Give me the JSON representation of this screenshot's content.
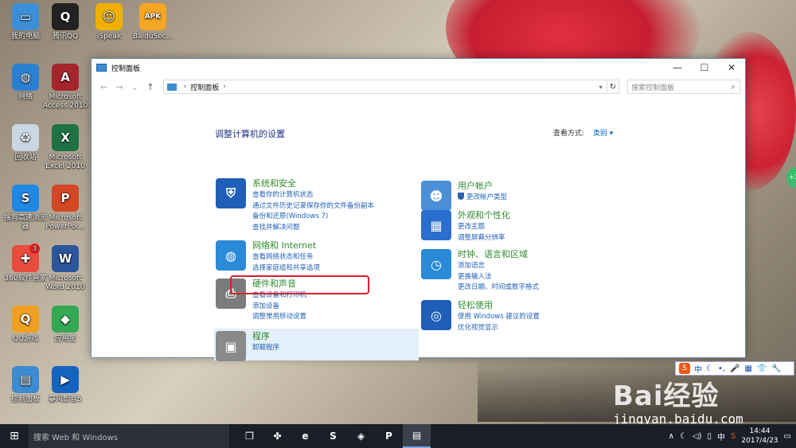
{
  "desktop": {
    "icons": [
      {
        "label": "我的电脑",
        "icon": "computer-icon",
        "color": "#3c8fd6",
        "glyph": "▭"
      },
      {
        "label": "腾讯QQ",
        "icon": "qq-icon",
        "color": "#222222",
        "glyph": "Q"
      },
      {
        "label": "iSpeak",
        "icon": "ispeak-icon",
        "color": "#f0b000",
        "glyph": "☺"
      },
      {
        "label": "BaiduSec...",
        "icon": "apk-icon",
        "color": "#f5a623",
        "glyph": "APK"
      },
      {
        "label": "网络",
        "icon": "network-icon",
        "color": "#2b7fd0",
        "glyph": "◍"
      },
      {
        "label": "Microsoft Access 2010",
        "icon": "access-icon",
        "color": "#a4262c",
        "glyph": "A"
      },
      {
        "label": "回收站",
        "icon": "recycle-bin-icon",
        "color": "#c9d6e3",
        "glyph": "♻"
      },
      {
        "label": "Microsoft Excel 2010",
        "icon": "excel-icon",
        "color": "#1f7244",
        "glyph": "X"
      },
      {
        "label": "搜狗高速浏览器",
        "icon": "sogou-browser-icon",
        "color": "#1e88e5",
        "glyph": "S"
      },
      {
        "label": "Microsoft PowerPoi...",
        "icon": "powerpoint-icon",
        "color": "#d24726",
        "glyph": "P"
      },
      {
        "label": "360软件管家",
        "icon": "360-manager-icon",
        "color": "#e84c3d",
        "glyph": "✚"
      },
      {
        "label": "Microsoft Word 2010",
        "icon": "word-icon",
        "color": "#2b579a",
        "glyph": "W"
      },
      {
        "label": "QQ游戏",
        "icon": "qq-game-icon",
        "color": "#f0a020",
        "glyph": "Q"
      },
      {
        "label": "应用宝",
        "icon": "yingyongbao-icon",
        "color": "#34a853",
        "glyph": "◆"
      },
      {
        "label": "控制面板",
        "icon": "control-panel-icon",
        "color": "#3d8bd1",
        "glyph": "▤"
      },
      {
        "label": "暴风影音5",
        "icon": "baofeng-icon",
        "color": "#1565c0",
        "glyph": "▶"
      }
    ],
    "badge_360": "3"
  },
  "window": {
    "title": "控制面板",
    "minimize": "—",
    "maximize": "☐",
    "close": "✕",
    "address": {
      "root": "控制面板",
      "sep": "›"
    },
    "search_placeholder": "搜索控制面板",
    "heading": "调整计算机的设置",
    "view_by_label": "查看方式:",
    "view_by_value": "类别 ▾",
    "categories_left": [
      {
        "title": "系统和安全",
        "icon": "shield-icon",
        "color": "#1f5fb8",
        "glyph": "⛨",
        "links": [
          "查看你的计算机状态",
          "通过文件历史记录保存你的文件备份副本",
          "备份和还原(Windows 7)",
          "查找并解决问题"
        ]
      },
      {
        "title": "网络和 Internet",
        "icon": "network-globe-icon",
        "color": "#2b8ad8",
        "glyph": "◍",
        "links": [
          "查看网络状态和任务",
          "选择家庭组和共享选项"
        ]
      },
      {
        "title": "硬件和声音",
        "icon": "printer-icon",
        "color": "#7b7b7b",
        "glyph": "⎙",
        "links": [
          "查看设备和打印机",
          "添加设备",
          "调整常用移动设置"
        ]
      },
      {
        "title": "程序",
        "icon": "programs-icon",
        "color": "#8a8a8a",
        "glyph": "▣",
        "links": [
          "卸载程序"
        ]
      }
    ],
    "categories_right": [
      {
        "title": "用户帐户",
        "icon": "users-icon",
        "color": "#4a8fd8",
        "glyph": "☻",
        "links": [
          "更改帐户类型"
        ]
      },
      {
        "title": "外观和个性化",
        "icon": "personalization-icon",
        "color": "#2a6fcf",
        "glyph": "▦",
        "links": [
          "更改主题",
          "调整屏幕分辨率"
        ]
      },
      {
        "title": "时钟、语言和区域",
        "icon": "clock-globe-icon",
        "color": "#2b8ad8",
        "glyph": "◷",
        "links": [
          "添加语言",
          "更换输入法",
          "更改日期、时间或数字格式"
        ]
      },
      {
        "title": "轻松使用",
        "icon": "ease-of-access-icon",
        "color": "#1f5fb8",
        "glyph": "◎",
        "links": [
          "使用 Windows 建议的设置",
          "优化视觉显示"
        ]
      }
    ]
  },
  "ime": {
    "lang": "中",
    "items": [
      "☾",
      "•,",
      "🎤",
      "▦",
      "👕",
      "🔧"
    ]
  },
  "watermark": {
    "brand": "Bai经验",
    "url": "jingyan.baidu.com"
  },
  "taskbar": {
    "start_glyph": "⊞",
    "search_text": "搜索 Web 和 Windows",
    "apps": [
      {
        "name": "task-view-button",
        "glyph": "❐"
      },
      {
        "name": "fan-app-button",
        "glyph": "✤"
      },
      {
        "name": "edge-button",
        "glyph": "e"
      },
      {
        "name": "sogou-button",
        "glyph": "S"
      },
      {
        "name": "fox-app-button",
        "glyph": "◈"
      },
      {
        "name": "powerpoint-taskbar-button",
        "glyph": "P"
      },
      {
        "name": "control-panel-taskbar-button",
        "glyph": "▤"
      }
    ],
    "tray": {
      "chevron": "∧",
      "lang": "中",
      "time": "14:44",
      "date": "2017/4/23"
    }
  }
}
